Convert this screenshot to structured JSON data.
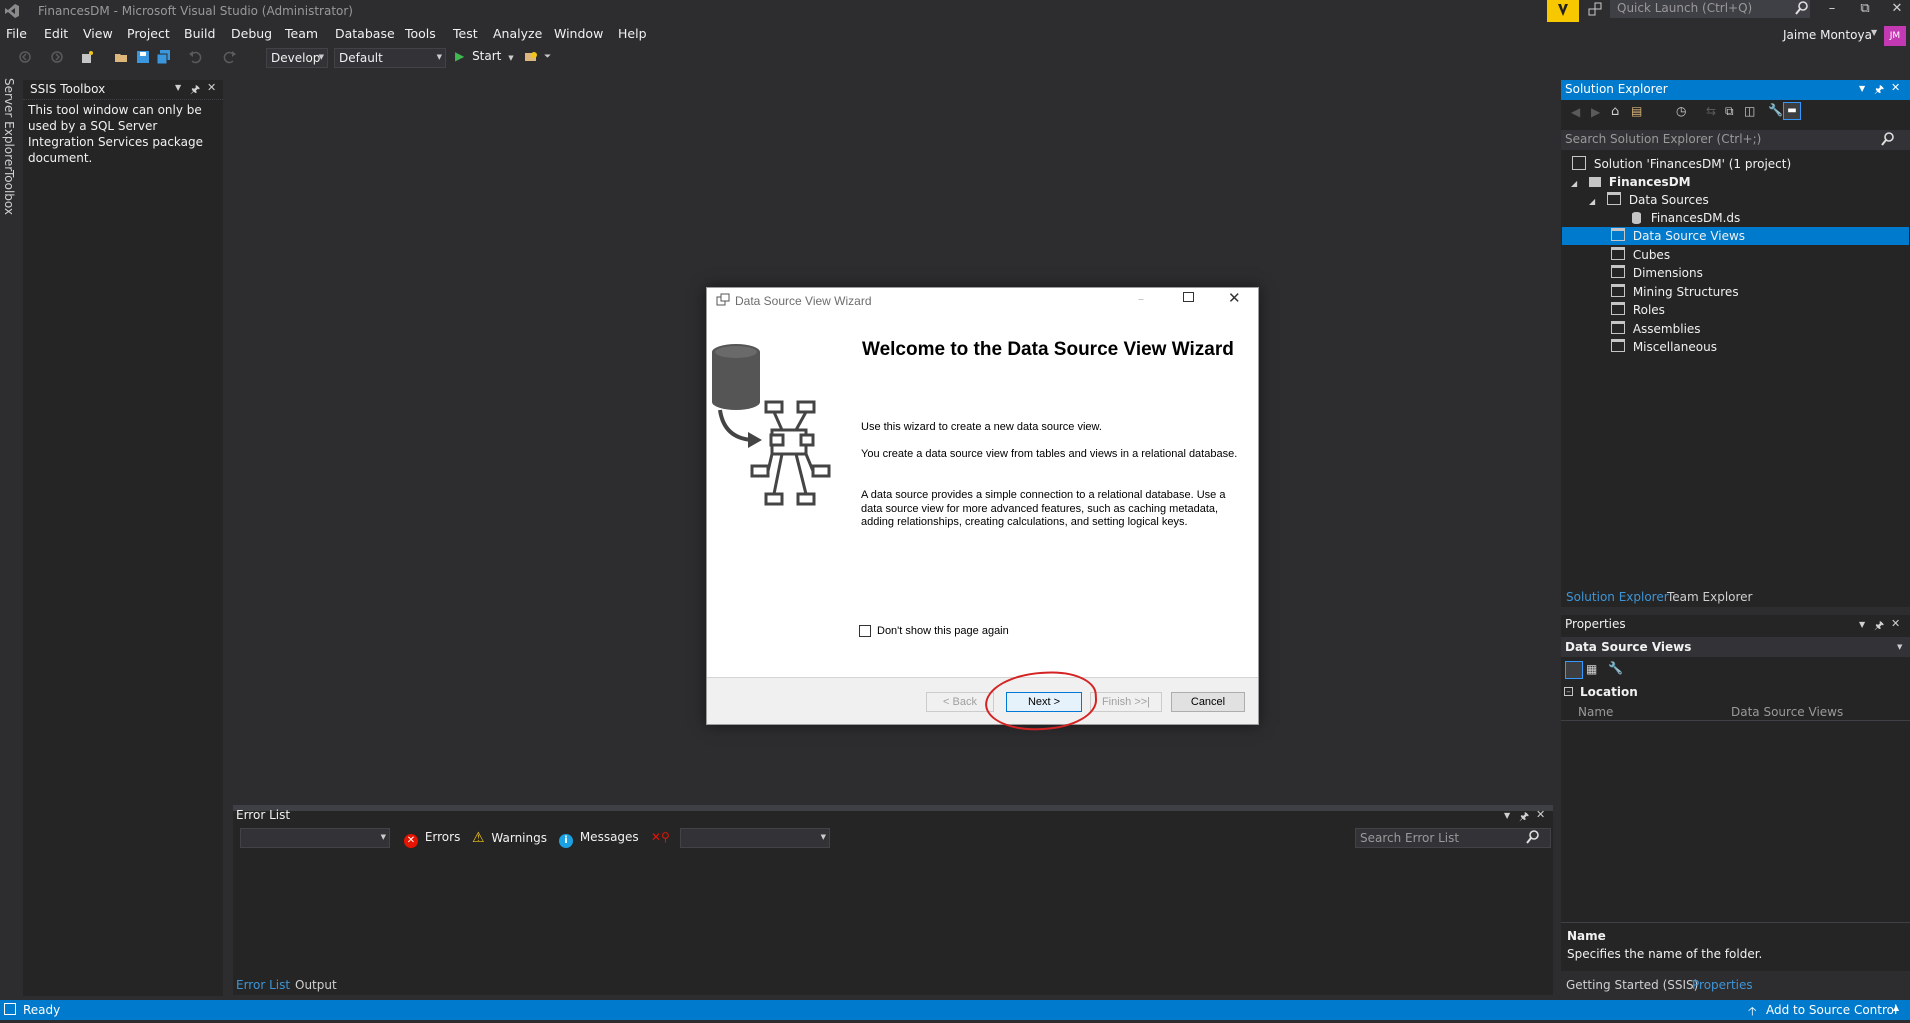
{
  "window": {
    "title": "FinancesDM - Microsoft Visual Studio  (Administrator)",
    "quick_launch_placeholder": "Quick Launch (Ctrl+Q)",
    "user_name": "Jaime Montoya",
    "user_initials": "JM"
  },
  "menu": [
    "File",
    "Edit",
    "View",
    "Project",
    "Build",
    "Debug",
    "Team",
    "Database",
    "Tools",
    "Test",
    "Analyze",
    "Window",
    "Help"
  ],
  "toolbar": {
    "config": "Develop",
    "platform": "Default",
    "start_label": "Start"
  },
  "left_tabs": [
    "Server Explorer",
    "Toolbox"
  ],
  "ssis_toolbox": {
    "title": "SSIS Toolbox",
    "message": "This tool window can only be used by a SQL Server Integration Services package document."
  },
  "error_list": {
    "title": "Error List",
    "errors_label": "Errors",
    "warnings_label": "Warnings",
    "messages_label": "Messages",
    "search_placeholder": "Search Error List",
    "tabs": [
      "Error List",
      "Output"
    ]
  },
  "solution_explorer": {
    "title": "Solution Explorer",
    "search_placeholder": "Search Solution Explorer (Ctrl+;)",
    "tree": [
      {
        "label": "Solution 'FinancesDM' (1 project)",
        "level": 0,
        "type": "solution"
      },
      {
        "label": "FinancesDM",
        "level": 1,
        "type": "project",
        "bold": true,
        "expanded": true
      },
      {
        "label": "Data Sources",
        "level": 2,
        "type": "folder",
        "expanded": true
      },
      {
        "label": "FinancesDM.ds",
        "level": 3,
        "type": "file"
      },
      {
        "label": "Data Source Views",
        "level": 2,
        "type": "folder",
        "selected": true
      },
      {
        "label": "Cubes",
        "level": 2,
        "type": "folder"
      },
      {
        "label": "Dimensions",
        "level": 2,
        "type": "folder"
      },
      {
        "label": "Mining Structures",
        "level": 2,
        "type": "folder"
      },
      {
        "label": "Roles",
        "level": 2,
        "type": "folder"
      },
      {
        "label": "Assemblies",
        "level": 2,
        "type": "folder"
      },
      {
        "label": "Miscellaneous",
        "level": 2,
        "type": "folder"
      }
    ],
    "tabs": [
      "Solution Explorer",
      "Team Explorer"
    ]
  },
  "properties": {
    "title": "Properties",
    "object": "Data Source Views",
    "category": "Location",
    "rows": [
      {
        "name": "Name",
        "value": "Data Source Views"
      }
    ],
    "desc_name": "Name",
    "desc_text": "Specifies the name of the folder.",
    "tabs": [
      "Getting Started (SSIS)",
      "Properties"
    ]
  },
  "status": {
    "text": "Ready",
    "source_control": "Add to Source Control"
  },
  "dialog": {
    "title": "Data Source View Wizard",
    "heading": "Welcome to the Data Source View Wizard",
    "para1": "Use this wizard to create a new data source view.",
    "para2": " You create a data source view from tables and views in a relational database.",
    "para3": " A data source provides a simple connection to a relational database. Use a data source view for more advanced features, such as caching metadata, adding relationships, creating calculations, and setting logical keys.",
    "checkbox_label": "Don't show this page again",
    "checkbox_checked": false,
    "back_label": "< Back",
    "next_label": "Next >",
    "finish_label": "Finish >>|",
    "cancel_label": "Cancel"
  },
  "colors": {
    "accent": "#007acc",
    "background": "#2d2d30",
    "panel": "#252526",
    "annotation": "#d42323"
  }
}
